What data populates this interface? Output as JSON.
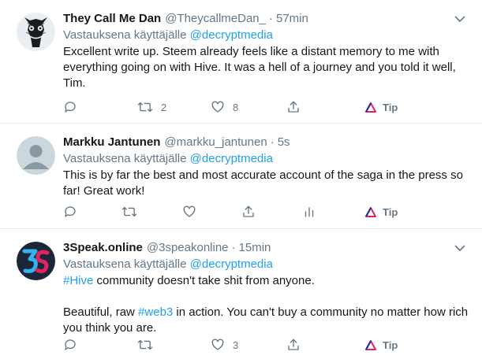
{
  "tweets": [
    {
      "name": "They Call Me Dan",
      "handle": "@TheycallmeDan_",
      "dot": "·",
      "time": "57min",
      "reply_prefix": "Vastauksena käyttäjälle",
      "reply_mention": "@decryptmedia",
      "text": "Excellent write up. Steem already feels like a distant memory to me with everything going on with Hive. It was a hell of a journey and you told it well, Tim.",
      "retweets": "2",
      "likes": "8",
      "tip": "Tip",
      "avatar_icon": "dark-mask-avatar"
    },
    {
      "name": "Markku Jantunen",
      "handle": "@markku_jantunen",
      "dot": "·",
      "time": "5s",
      "reply_prefix": "Vastauksena käyttäjälle",
      "reply_mention": "@decryptmedia",
      "text": "This is by far the best and most accurate account of the saga in the press so far! Great work!",
      "tip": "Tip",
      "avatar_icon": "default-profile-avatar"
    },
    {
      "name": "3Speak.online",
      "handle": "@3speakonline",
      "dot": "·",
      "time": "15min",
      "reply_prefix": "Vastauksena käyttäjälle",
      "reply_mention": "@decryptmedia",
      "text_line1_tag": "#Hive",
      "text_line1_rest": " community doesn't take shit from anyone.",
      "text_line2_pre": "Beautiful, raw ",
      "text_line2_tag": "#web3",
      "text_line2_rest": " in action. You can't buy a community no matter how rich you think you are.",
      "likes": "3",
      "tip": "Tip",
      "avatar_icon": "3s-logo-avatar"
    }
  ],
  "colors": {
    "accent": "#1da1f2",
    "muted": "#657786",
    "text": "#14171a",
    "divider": "#e6ecf0",
    "tip": "#e0245e"
  }
}
